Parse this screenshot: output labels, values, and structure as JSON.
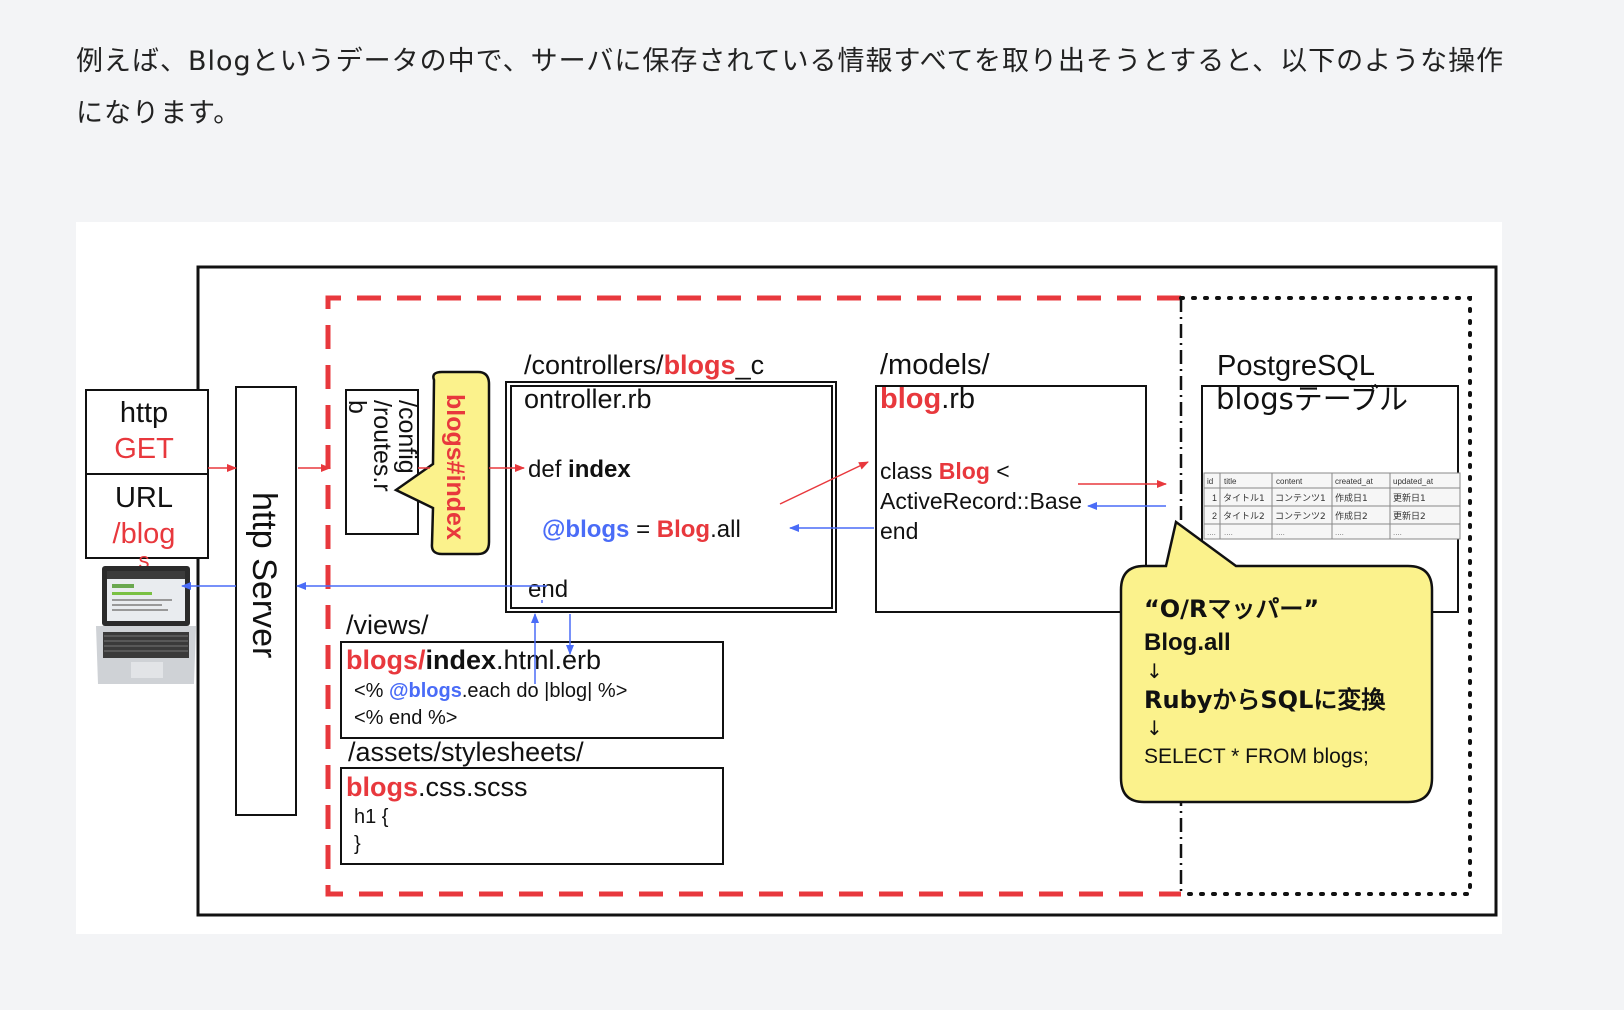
{
  "intro": {
    "line1": "例えば、Blogというデータの中で、サーバに保存されている情報すべてを取り出そうとすると、以下のような操作",
    "line2": "になります。"
  },
  "diagram": {
    "client": {
      "method_label": "http",
      "method_value": "GET",
      "url_label": "URL",
      "url_value": "/blog",
      "url_value_cont": "s"
    },
    "server_label": "http Server",
    "routes": {
      "path_line1": "/config",
      "path_line2": "/routes.r",
      "path_line3": "b",
      "callout": "blogs#index"
    },
    "controller": {
      "path_prefix": "/controllers/",
      "path_red": "blogs",
      "path_suffix": "_c",
      "filename": "ontroller.rb",
      "def_keyword": "def",
      "method_name": "index",
      "ivar": "@blogs",
      "equals": "=",
      "model_call_red": "Blog",
      "model_call_suffix": ".all",
      "end_keyword": "end"
    },
    "model": {
      "path": "/models/",
      "file_red": "blog",
      "file_suffix": ".rb",
      "class_keyword": "class",
      "class_name": "Blog",
      "lt": "<",
      "superclass": "ActiveRecord::Base",
      "end_keyword": "end"
    },
    "db": {
      "title": "PostgreSQL",
      "table_label": "blogsテーブル",
      "columns": [
        "id",
        "title",
        "content",
        "created_at",
        "updated_at"
      ],
      "rows": [
        [
          "1",
          "タイトル1",
          "コンテンツ1",
          "作成日1",
          "更新日1"
        ],
        [
          "2",
          "タイトル2",
          "コンテンツ2",
          "作成日2",
          "更新日2"
        ],
        [
          "....",
          "....",
          "....",
          "....",
          "...."
        ]
      ]
    },
    "orm_callout": {
      "line1": "“O/Rマッパー”",
      "line2": "Blog.all",
      "arrow": "↓",
      "line3": "RubyからSQLに変換",
      "line4": "SELECT * FROM blogs;"
    },
    "views": {
      "path": "/views/",
      "file_red": "blogs/",
      "file_bold": "index",
      "file_suffix": ".html.erb",
      "code1_open": "<%",
      "code1_ivar": "@blogs",
      "code1_rest": ".each do |blog| %>",
      "code2": "<% end %>"
    },
    "assets": {
      "path": "/assets/stylesheets/",
      "file_red": "blogs",
      "file_suffix": ".css.scss",
      "code1": "h1 {",
      "code2": "}"
    },
    "colors": {
      "red": "#e8383d",
      "blue": "#4a6cf7",
      "callout_yellow": "#fbf28c"
    }
  }
}
